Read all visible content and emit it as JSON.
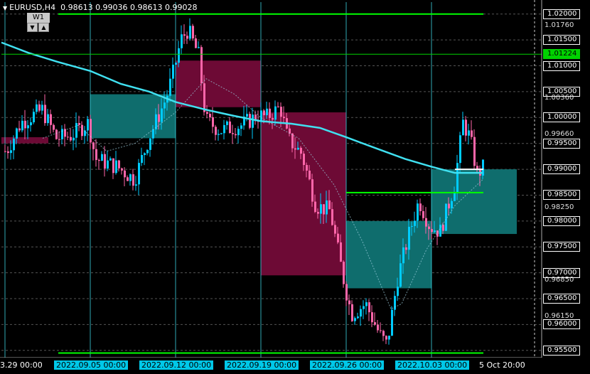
{
  "header": {
    "symbol_tf": "EURUSD,H4",
    "ohlc": "0.98613 0.99036 0.98613 0.99028"
  },
  "timeframe": {
    "label": "W1",
    "down_glyph": "▼",
    "up_glyph": "▲"
  },
  "colors": {
    "background": "#000000",
    "bull_candle": "#00ccff",
    "bear_candle": "#ff66aa",
    "moving_average": "#40e0f0",
    "level_line": "#00ff00",
    "teal_box": "#0f6d6d",
    "crimson_box": "#6d0a35",
    "grid": "#2a2a2a",
    "vertical_marker": "#40e0f0"
  },
  "price_axis": {
    "labels": [
      "1.02000",
      "1.01760",
      "1.01500",
      "1.01000",
      "1.00500",
      "1.00360",
      "1.00000",
      "0.99660",
      "0.99500",
      "0.99000",
      "0.98500",
      "0.98250",
      "0.98000",
      "0.97500",
      "0.97000",
      "0.96850",
      "0.96500",
      "0.96150",
      "0.96000",
      "0.95500"
    ],
    "boxed": [
      "1.02000",
      "1.01500",
      "1.01000",
      "1.00500",
      "1.00000",
      "0.99500",
      "0.99000",
      "0.98500",
      "0.98000",
      "0.97500",
      "0.97000",
      "0.96500",
      "0.96000",
      "0.95500"
    ],
    "current_price": "1.01224",
    "current_price_green": true
  },
  "time_axis": {
    "labels": [
      {
        "text": "3.29 00:00",
        "hl": false
      },
      {
        "text": "2022.09.05 00:00",
        "hl": true
      },
      {
        "text": "2022.09.12 00:00",
        "hl": true
      },
      {
        "text": "2022.09.19 00:00",
        "hl": true
      },
      {
        "text": "2022.09.26 00:00",
        "hl": true
      },
      {
        "text": "2022.10.03 00:00",
        "hl": true
      },
      {
        "text": "5 Oct 20:00",
        "hl": false
      }
    ]
  },
  "levels": {
    "top": 1.02,
    "upper_support": 0.9855,
    "bottom": 0.9545,
    "current_marker": 0.99
  },
  "chart_data": {
    "type": "candlestick",
    "symbol": "EURUSD",
    "timeframe": "H4",
    "ylim": [
      0.9536,
      1.0223
    ],
    "weeks": [
      "2022.09.05",
      "2022.09.12",
      "2022.09.19",
      "2022.09.26",
      "2022.10.03"
    ],
    "weekly_boxes": [
      {
        "open": 0.996,
        "close": 1.0045,
        "bull": true
      },
      {
        "open": 1.011,
        "close": 1.002,
        "bull": false
      },
      {
        "open": 1.001,
        "close": 0.9695,
        "bull": false
      },
      {
        "open": 0.967,
        "close": 0.98,
        "bull": true
      },
      {
        "open": 0.9775,
        "close": 0.99,
        "bull": true
      }
    ],
    "sma_weekly_anchor": [
      1.015,
      1.012,
      1.009,
      1.0045,
      1.001,
      0.999,
      0.996,
      0.992,
      0.99,
      0.99
    ]
  }
}
